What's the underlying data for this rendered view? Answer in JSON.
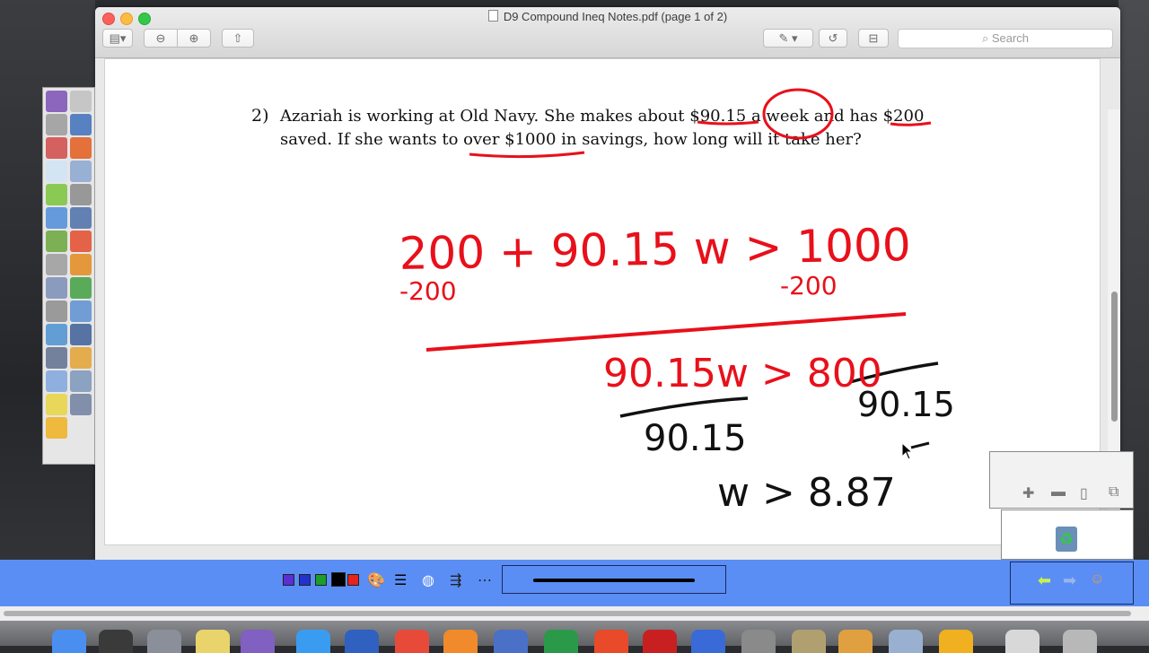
{
  "window": {
    "title": "D9 Compound Ineq Notes.pdf (page 1 of 2)",
    "search_placeholder": "Search"
  },
  "toolbar": {
    "sidebar_icon": "sidebar-icon",
    "zoom_out_icon": "zoom-out-icon",
    "zoom_in_icon": "zoom-in-icon",
    "share_icon": "share-icon",
    "markup_icon": "pen-markup-icon",
    "rotate_icon": "rotate-icon",
    "toolbox_icon": "toolbox-icon"
  },
  "document": {
    "problem_number": "2)",
    "problem_line1": "Azariah is working at Old Navy.  She makes about $90.15 a week and has $200",
    "problem_line2": "saved.  If she wants to over $1000 in savings, how long will it take her?",
    "handwriting": {
      "eq1": "200 + 90.15 w > 1000",
      "sub_left": "-200",
      "sub_right": "-200",
      "eq2": "90.15w > 800",
      "div_left": "90.15",
      "div_right": "90.15",
      "result": "w > 8.87"
    }
  },
  "palette": {
    "tools": [
      "ws-logo-icon",
      "pointer-icon",
      "select-arrow-icon",
      "pen-icon",
      "eraser-icon",
      "delete-icon",
      "new-page-icon",
      "copy-icon",
      "back-arrow-icon",
      "forward-arrow-icon",
      "grid-icon",
      "save-icon",
      "printer-icon",
      "cancel-icon",
      "tools-icon",
      "undo-icon",
      "ruler-icon",
      "spellcheck-icon",
      "text-tool-icon",
      "document-icon",
      "shapes-icon",
      "highlighter-icon",
      "camera-icon",
      "stamp-icon",
      "pages-icon",
      "screen-capture-icon",
      "magic-wand-icon",
      "recorder-icon",
      "bell-icon"
    ]
  },
  "bottom_bar": {
    "colors": [
      "#5a2fd4",
      "#2233cc",
      "#1d9e2a",
      "#000000",
      "#e8231c"
    ],
    "line_style_icons": [
      "palette-icon",
      "line-width-icon",
      "fill-icon",
      "arrow-style-icon",
      "dash-style-icon"
    ]
  },
  "floating_panel": {
    "buttons": [
      "plus-icon",
      "minus-icon",
      "clipboard-icon",
      "duplicate-icon"
    ],
    "refresh_icon": "recycle-icon",
    "nav_icons": [
      "back-arrow-icon",
      "forward-arrow-icon",
      "user-icon"
    ]
  },
  "dock": {
    "apps": [
      "finder-icon",
      "app-icon",
      "launchpad-icon",
      "stickies-icon",
      "ws-icon",
      "safari-icon",
      "calendar-icon",
      "chrome-icon",
      "firefox-icon",
      "disk-icon",
      "excel-icon",
      "app-icon",
      "acrobat-icon",
      "word-icon",
      "settings-icon",
      "preview-icon",
      "photos-icon",
      "contacts-icon",
      "itunes-icon",
      "app-icon",
      "trash-icon"
    ]
  }
}
